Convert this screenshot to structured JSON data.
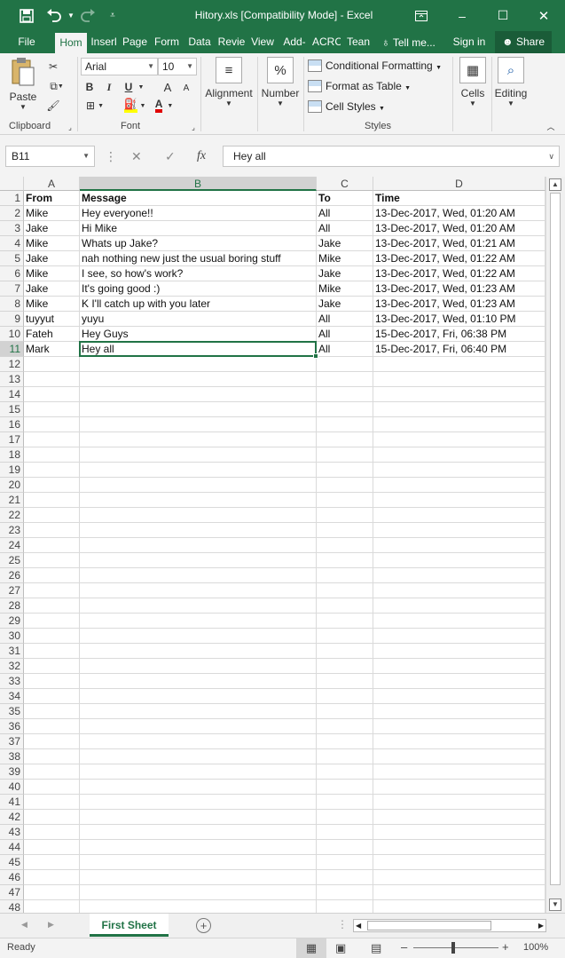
{
  "title_bar": {
    "title": "Hitory.xls  [Compatibility Mode] - Excel",
    "save_icon": "floppy-disk-icon",
    "undo_icon": "undo-arrow-icon",
    "redo_icon": "redo-arrow-icon",
    "customize_icon": "customize-toolbar-icon",
    "ribbon_display_icon": "ribbon-display-options-icon",
    "minimize_label": "–",
    "maximize_label": "☐",
    "close_label": "✕"
  },
  "tabs": [
    {
      "label": "File"
    },
    {
      "label": "Hom"
    },
    {
      "label": "Inserl"
    },
    {
      "label": "Page"
    },
    {
      "label": "Form"
    },
    {
      "label": "Data"
    },
    {
      "label": "Revie"
    },
    {
      "label": "View"
    },
    {
      "label": "Add-"
    },
    {
      "label": "ACRC"
    },
    {
      "label": "Tean"
    },
    {
      "label": "Tell me..."
    },
    {
      "label": "Sign in"
    },
    {
      "label": "Share"
    }
  ],
  "ribbon": {
    "clipboard": {
      "paste_label": "Paste",
      "group_label": "Clipboard"
    },
    "font": {
      "font_name": "Arial",
      "font_size": "10",
      "bold_label": "B",
      "italic_label": "I",
      "underline_label": "U",
      "grow_label": "A",
      "shrink_label": "A",
      "font_color_label": "A",
      "group_label": "Font"
    },
    "alignment": {
      "label": "Alignment"
    },
    "number": {
      "label": "Number",
      "icon_text": "%"
    },
    "styles": {
      "conditional_formatting": "Conditional Formatting",
      "format_as_table": "Format as Table",
      "cell_styles": "Cell Styles",
      "group_label": "Styles"
    },
    "cells": {
      "label": "Cells"
    },
    "editing": {
      "label": "Editing"
    }
  },
  "formula_bar": {
    "name_box": "B11",
    "fx_label": "fx",
    "cancel_label": "✕",
    "enter_label": "✓",
    "value": "Hey all"
  },
  "sheet": {
    "columns": [
      "A",
      "B",
      "C",
      "D"
    ],
    "selected_column": "B",
    "selected_row": 11,
    "rows": [
      [
        "From",
        "Message",
        "To",
        "Time"
      ],
      [
        "Mike",
        "Hey everyone!!",
        "All",
        "13-Dec-2017, Wed, 01:20 AM"
      ],
      [
        "Jake",
        "Hi Mike",
        "All",
        "13-Dec-2017, Wed, 01:20 AM"
      ],
      [
        "Mike",
        "Whats up Jake?",
        "Jake",
        "13-Dec-2017, Wed, 01:21 AM"
      ],
      [
        "Jake",
        "nah nothing new just the usual boring stuff",
        "Mike",
        "13-Dec-2017, Wed, 01:22 AM"
      ],
      [
        "Mike",
        "I see, so how's work?",
        "Jake",
        "13-Dec-2017, Wed, 01:22 AM"
      ],
      [
        "Jake",
        "It's going good :)",
        "Mike",
        "13-Dec-2017, Wed, 01:23 AM"
      ],
      [
        "Mike",
        "K I'll catch up with you later",
        "Jake",
        "13-Dec-2017, Wed, 01:23 AM"
      ],
      [
        "tuyyut",
        "yuyu",
        "All",
        "13-Dec-2017, Wed, 01:10 PM"
      ],
      [
        "Fateh",
        "Hey Guys",
        "All",
        "15-Dec-2017, Fri, 06:38 PM"
      ],
      [
        "Mark",
        "Hey all",
        "All",
        "15-Dec-2017, Fri, 06:40 PM"
      ]
    ],
    "row_numbers": [
      1,
      2,
      3,
      4,
      5,
      6,
      7,
      8,
      9,
      10,
      11,
      12,
      13,
      14,
      15,
      16,
      17,
      18,
      19,
      20,
      21,
      22,
      23,
      24,
      25,
      26,
      27,
      28,
      29,
      30,
      31,
      32,
      33,
      34,
      35,
      36,
      37,
      38,
      39,
      40,
      41,
      42,
      43,
      44,
      45,
      46,
      47,
      48
    ]
  },
  "sheet_tabs": {
    "active": "First Sheet",
    "add_label": "+"
  },
  "status_bar": {
    "status": "Ready",
    "zoom": "100%",
    "zoom_out_label": "–",
    "zoom_in_label": "+"
  }
}
